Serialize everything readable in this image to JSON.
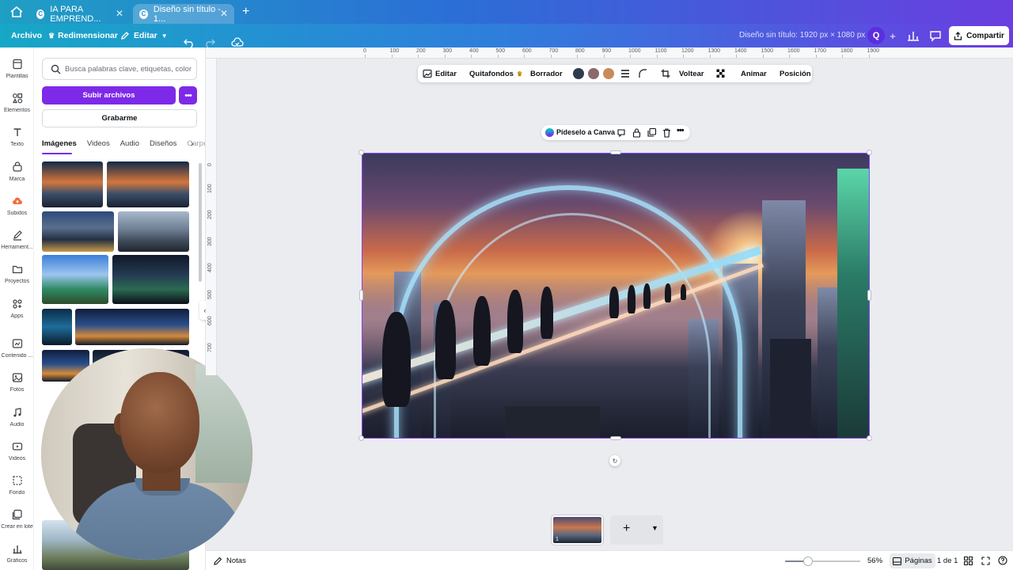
{
  "browser": {
    "tabs": [
      {
        "title": "IA PARA EMPREND..."
      },
      {
        "title": "Diseño sin título - 1..."
      }
    ]
  },
  "header": {
    "file_label": "Archivo",
    "resize_label": "Redimensionar",
    "edit_label": "Editar",
    "doc_title": "Diseño sin título: 1920 px × 1080 px",
    "avatar_initial": "Q",
    "share_label": "Compartir"
  },
  "rail": [
    {
      "label": "Plantillas",
      "icon": "layout-icon"
    },
    {
      "label": "Elementos",
      "icon": "shapes-icon"
    },
    {
      "label": "Texto",
      "icon": "text-icon"
    },
    {
      "label": "Marca",
      "icon": "brand-icon"
    },
    {
      "label": "Subidos",
      "icon": "upload-cloud-icon"
    },
    {
      "label": "Herramient...",
      "icon": "draw-icon"
    },
    {
      "label": "Proyectos",
      "icon": "folder-icon"
    },
    {
      "label": "Apps",
      "icon": "apps-icon"
    },
    {
      "label": "Contenido ...",
      "icon": "magic-media-icon"
    },
    {
      "label": "Fotos",
      "icon": "photo-icon"
    },
    {
      "label": "Audio",
      "icon": "music-icon"
    },
    {
      "label": "Videos",
      "icon": "video-icon"
    },
    {
      "label": "Fondo",
      "icon": "background-icon"
    },
    {
      "label": "Crear en lote",
      "icon": "bulk-create-icon"
    },
    {
      "label": "Gráficos",
      "icon": "chart-icon"
    }
  ],
  "panel": {
    "search_placeholder": "Busca palabras clave, etiquetas, color",
    "upload_label": "Subir archivos",
    "more_label": "•••",
    "record_label": "Grabarme",
    "tabs": [
      "Imágenes",
      "Videos",
      "Audio",
      "Diseños",
      "Carpe"
    ],
    "active_tab": "Imágenes"
  },
  "ruler": {
    "top_ticks": [
      "0",
      "100",
      "200",
      "300",
      "400",
      "500",
      "600",
      "700",
      "800",
      "900",
      "1000",
      "1100",
      "1200",
      "1300",
      "1400",
      "1500",
      "1600",
      "1700",
      "1800",
      "1900"
    ],
    "left_ticks": [
      "0",
      "100",
      "200",
      "300",
      "400",
      "500",
      "600",
      "700"
    ]
  },
  "context_toolbar": {
    "edit_label": "Editar",
    "bg_remover_label": "Quitafondos",
    "eraser_label": "Borrador",
    "colors": [
      "#2f3a4f",
      "#8a6a6a",
      "#c98a5a"
    ],
    "flip_label": "Voltear",
    "animate_label": "Animar",
    "position_label": "Posición"
  },
  "magic_bar": {
    "label": "Pídeselo a Canva"
  },
  "pages": {
    "current_page_number": "1"
  },
  "footer": {
    "notes_label": "Notas",
    "zoom_percent": "56%",
    "zoom_fraction": 0.31,
    "pages_label": "Páginas",
    "page_count": "1 de 1"
  }
}
